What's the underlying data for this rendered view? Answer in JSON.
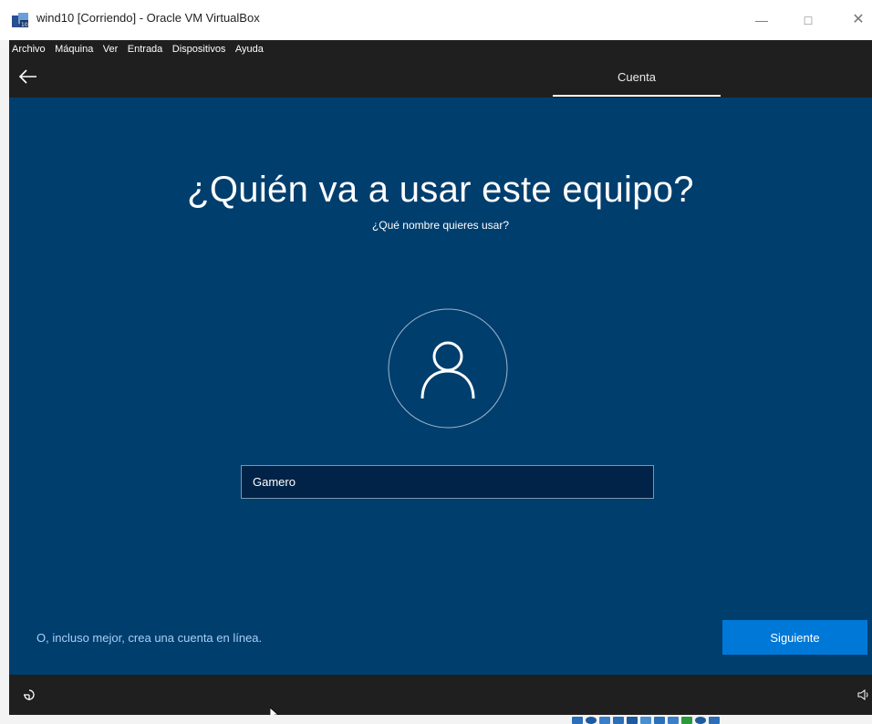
{
  "window": {
    "title": "wind10 [Corriendo] - Oracle VM VirtualBox",
    "app_icon": "virtualbox-icon",
    "controls": [
      "minimize-icon",
      "maximize-icon",
      "close-icon"
    ]
  },
  "menu": {
    "items": [
      {
        "label": "Archivo"
      },
      {
        "label": "Máquina"
      },
      {
        "label": "Ver"
      },
      {
        "label": "Entrada"
      },
      {
        "label": "Dispositivos"
      },
      {
        "label": "Ayuda"
      }
    ]
  },
  "oobe": {
    "back_icon": "back-arrow-icon",
    "tab_label": "Cuenta",
    "heading": "¿Quién va a usar este equipo?",
    "subheading": "¿Qué nombre quieres usar?",
    "avatar_icon": "user-icon",
    "name_value": "Gamero",
    "online_link": "O, incluso mejor, crea una cuenta en línea.",
    "next_label": "Siguiente",
    "accessibility_icon": "accessibility-icon",
    "volume_icon": "volume-icon"
  },
  "colors": {
    "background": "#003e6e",
    "header": "#1f1f1f",
    "accent": "#0078d7",
    "link": "#a6d1f5",
    "input_bg": "#002347"
  }
}
